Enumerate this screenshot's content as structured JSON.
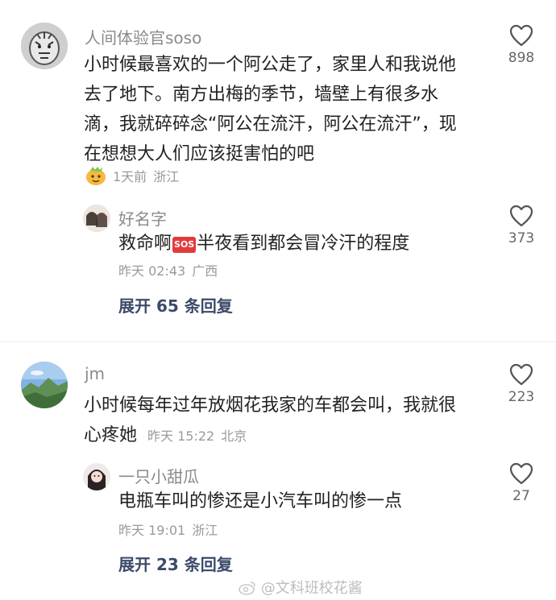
{
  "comments": [
    {
      "username": "人间体验官soso",
      "text": "小时候最喜欢的一个阿公走了，家里人和我说他去了地下。南方出梅的季节，墙壁上有很多水滴，我就碎碎念“阿公在流汗，阿公在流汗”，现在想想大人们应该挺害怕的吧",
      "time": "1天前",
      "location": "浙江",
      "likes": "898",
      "reply": {
        "username": "好名字",
        "text_before": "救命啊",
        "emoji": "SOS",
        "text_after": "半夜看到都会冒冷汗的程度",
        "time": "昨天 02:43",
        "location": "广西",
        "likes": "373"
      },
      "expand_label": "展开 65 条回复"
    },
    {
      "username": "jm",
      "text": "小时候每年过年放烟花我家的车都会叫，我就很心疼她",
      "time": "昨天 15:22",
      "location": "北京",
      "likes": "223",
      "reply": {
        "username": "一只小甜瓜",
        "text": "电瓶车叫的惨还是小汽车叫的惨一点",
        "time": "昨天 19:01",
        "location": "浙江",
        "likes": "27"
      },
      "expand_label": "展开 23 条回复"
    }
  ],
  "watermark": "@文科班校花酱",
  "colors": {
    "expand": "#3c4a6a",
    "meta": "#9a9a9a",
    "username": "#8a8a8a"
  }
}
